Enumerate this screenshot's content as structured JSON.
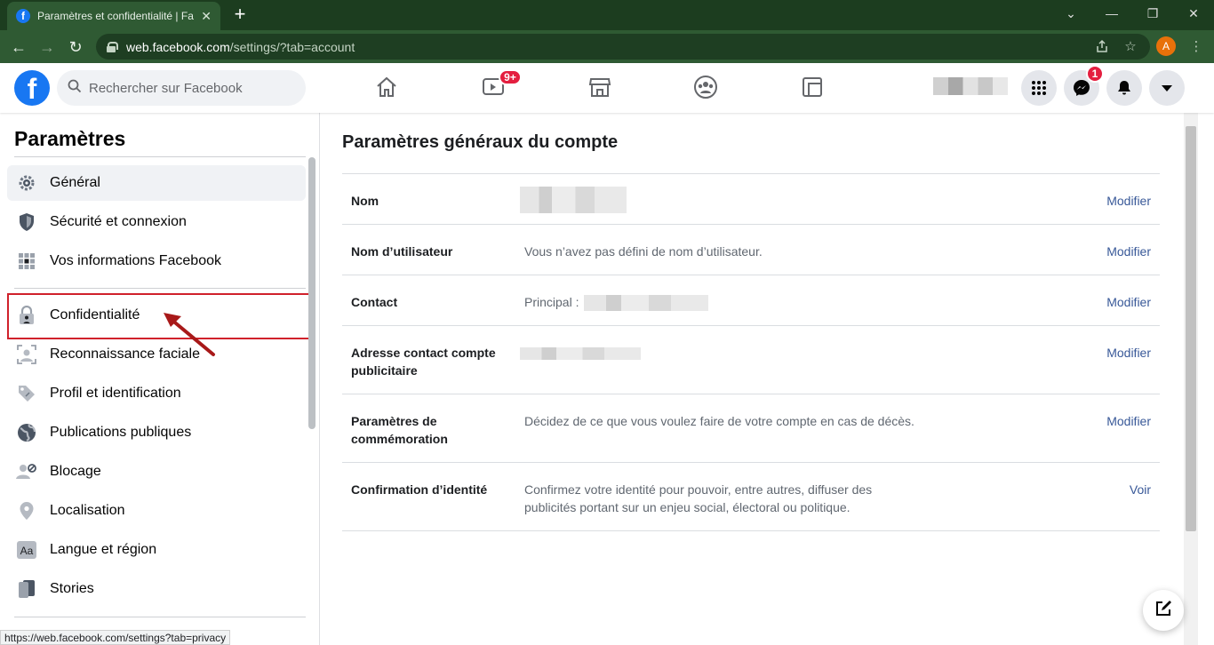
{
  "browser": {
    "tab_title": "Paramètres et confidentialité | Fa",
    "tab_close": "✕",
    "new_tab": "+",
    "url_host": "web.facebook.com",
    "url_path": "/settings/?tab=account",
    "profile_initial": "A",
    "window_controls": [
      "⌄",
      "—",
      "❐",
      "✕"
    ]
  },
  "fb_nav": {
    "logo": "f",
    "search_placeholder": "Rechercher sur Facebook",
    "watch_badge": "9+",
    "messenger_badge": "1"
  },
  "sidebar": {
    "title": "Paramètres",
    "items": [
      {
        "label": "Général",
        "icon": "gear-icon",
        "active": true
      },
      {
        "label": "Sécurité et connexion",
        "icon": "shield-icon"
      },
      {
        "label": "Vos informations Facebook",
        "icon": "grid-dots-icon"
      },
      {
        "label": "Confidentialité",
        "icon": "privacy-lock-icon",
        "highlighted": true
      },
      {
        "label": "Reconnaissance faciale",
        "icon": "face-recognition-icon"
      },
      {
        "label": "Profil et identification",
        "icon": "tag-icon"
      },
      {
        "label": "Publications publiques",
        "icon": "globe-icon"
      },
      {
        "label": "Blocage",
        "icon": "block-user-icon"
      },
      {
        "label": "Localisation",
        "icon": "location-pin-icon"
      },
      {
        "label": "Langue et région",
        "icon": "language-aa-icon"
      },
      {
        "label": "Stories",
        "icon": "book-icon"
      }
    ],
    "status_url": "https://web.facebook.com/settings?tab=privacy"
  },
  "main": {
    "title": "Paramètres généraux du compte",
    "rows": [
      {
        "label": "Nom",
        "value": "",
        "action": "Modifier"
      },
      {
        "label": "Nom d’utilisateur",
        "value": "Vous n’avez pas défini de nom d’utilisateur.",
        "action": "Modifier"
      },
      {
        "label": "Contact",
        "value": "Principal :",
        "action": "Modifier"
      },
      {
        "label": "Adresse contact compte publicitaire",
        "value": "",
        "action": "Modifier"
      },
      {
        "label": "Paramètres de commémoration",
        "value": "Décidez de ce que vous voulez faire de votre compte en cas de décès.",
        "action": "Modifier"
      },
      {
        "label": "Confirmation d’identité",
        "value": "Confirmez votre identité pour pouvoir, entre autres, diffuser des publicités portant sur un enjeu social, électoral ou politique.",
        "action": "Voir"
      }
    ]
  },
  "colors": {
    "fb_blue": "#1877f2",
    "link_blue": "#385898",
    "badge_red": "#e41e3f",
    "highlight_red": "#d0212b",
    "chrome_green": "#2f5a33"
  }
}
